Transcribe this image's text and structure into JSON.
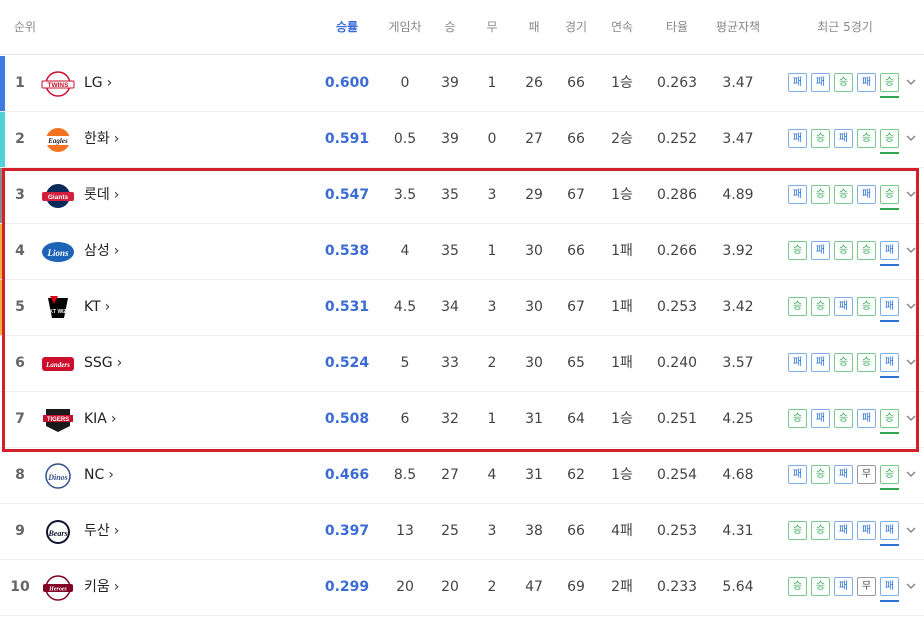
{
  "header": {
    "rank": "순위",
    "pct": "승률",
    "gb": "게임차",
    "win": "승",
    "draw": "무",
    "loss": "패",
    "games": "경기",
    "streak": "연속",
    "avg": "타율",
    "era": "평균자책",
    "recent": "최근 5경기"
  },
  "colors": {
    "accent": "#3b6bd6",
    "win_badge": "#2fa84f",
    "loss_badge": "#2a72d6",
    "highlight_box": "#d4202a",
    "rank_bar_1": "#3d7be3",
    "rank_bar_2": "#4fd2d8",
    "rank_bar_3to5": "#f2b233"
  },
  "rows": [
    {
      "rank": "1",
      "team": "LG",
      "logo": "twins-logo",
      "pct": "0.600",
      "gb": "0",
      "w": "39",
      "d": "1",
      "l": "26",
      "g": "66",
      "streak": "1승",
      "avg": "0.263",
      "era": "3.47",
      "recent": [
        "패",
        "패",
        "승",
        "패",
        "승"
      ]
    },
    {
      "rank": "2",
      "team": "한화",
      "logo": "eagles-logo",
      "pct": "0.591",
      "gb": "0.5",
      "w": "39",
      "d": "0",
      "l": "27",
      "g": "66",
      "streak": "2승",
      "avg": "0.252",
      "era": "3.47",
      "recent": [
        "패",
        "승",
        "패",
        "승",
        "승"
      ]
    },
    {
      "rank": "3",
      "team": "롯데",
      "logo": "giants-logo",
      "pct": "0.547",
      "gb": "3.5",
      "w": "35",
      "d": "3",
      "l": "29",
      "g": "67",
      "streak": "1승",
      "avg": "0.286",
      "era": "4.89",
      "recent": [
        "패",
        "승",
        "승",
        "패",
        "승"
      ]
    },
    {
      "rank": "4",
      "team": "삼성",
      "logo": "lions-logo",
      "pct": "0.538",
      "gb": "4",
      "w": "35",
      "d": "1",
      "l": "30",
      "g": "66",
      "streak": "1패",
      "avg": "0.266",
      "era": "3.92",
      "recent": [
        "승",
        "패",
        "승",
        "승",
        "패"
      ]
    },
    {
      "rank": "5",
      "team": "KT",
      "logo": "ktwiz-logo",
      "pct": "0.531",
      "gb": "4.5",
      "w": "34",
      "d": "3",
      "l": "30",
      "g": "67",
      "streak": "1패",
      "avg": "0.253",
      "era": "3.42",
      "recent": [
        "승",
        "승",
        "패",
        "승",
        "패"
      ]
    },
    {
      "rank": "6",
      "team": "SSG",
      "logo": "landers-logo",
      "pct": "0.524",
      "gb": "5",
      "w": "33",
      "d": "2",
      "l": "30",
      "g": "65",
      "streak": "1패",
      "avg": "0.240",
      "era": "3.57",
      "recent": [
        "패",
        "패",
        "승",
        "승",
        "패"
      ]
    },
    {
      "rank": "7",
      "team": "KIA",
      "logo": "tigers-logo",
      "pct": "0.508",
      "gb": "6",
      "w": "32",
      "d": "1",
      "l": "31",
      "g": "64",
      "streak": "1승",
      "avg": "0.251",
      "era": "4.25",
      "recent": [
        "승",
        "패",
        "승",
        "패",
        "승"
      ]
    },
    {
      "rank": "8",
      "team": "NC",
      "logo": "dinos-logo",
      "pct": "0.466",
      "gb": "8.5",
      "w": "27",
      "d": "4",
      "l": "31",
      "g": "62",
      "streak": "1승",
      "avg": "0.254",
      "era": "4.68",
      "recent": [
        "패",
        "승",
        "패",
        "무",
        "승"
      ]
    },
    {
      "rank": "9",
      "team": "두산",
      "logo": "bears-logo",
      "pct": "0.397",
      "gb": "13",
      "w": "25",
      "d": "3",
      "l": "38",
      "g": "66",
      "streak": "4패",
      "avg": "0.253",
      "era": "4.31",
      "recent": [
        "승",
        "승",
        "패",
        "패",
        "패"
      ]
    },
    {
      "rank": "10",
      "team": "키움",
      "logo": "heroes-logo",
      "pct": "0.299",
      "gb": "20",
      "w": "20",
      "d": "2",
      "l": "47",
      "g": "69",
      "streak": "2패",
      "avg": "0.233",
      "era": "5.64",
      "recent": [
        "승",
        "승",
        "패",
        "무",
        "패"
      ]
    }
  ]
}
